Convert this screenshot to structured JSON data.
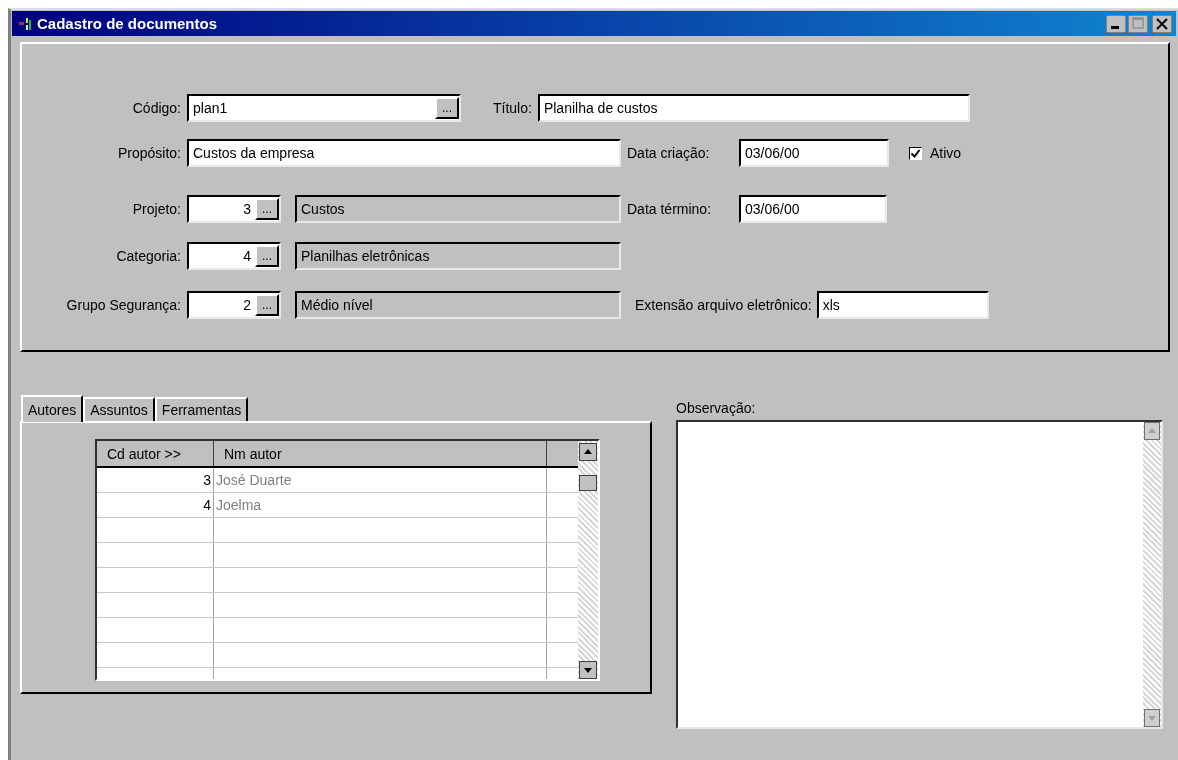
{
  "window": {
    "title": "Cadastro de documentos"
  },
  "codigo": {
    "label": "Código:",
    "value": "plan1",
    "button": "..."
  },
  "titulo": {
    "label": "Título:",
    "value": "Planilha de custos"
  },
  "proposito": {
    "label": "Propósito:",
    "value": "Custos da empresa"
  },
  "data_criacao": {
    "label": "Data criação:",
    "value": "03/06/00"
  },
  "ativo": {
    "label": "Ativo",
    "checked": true
  },
  "lookups": [
    {
      "label": "Projeto:",
      "code": "3",
      "button": "...",
      "description": "Custos"
    },
    {
      "label": "Categoria:",
      "code": "4",
      "button": "...",
      "description": "Planilhas eletrônicas"
    },
    {
      "label": "Grupo Segurança:",
      "code": "2",
      "button": "...",
      "description": "Médio nível"
    }
  ],
  "data_termino": {
    "label": "Data término:",
    "value": "03/06/00"
  },
  "extensao": {
    "label": "Extensão arquivo eletrônico:",
    "value": "xls"
  },
  "tabs": [
    {
      "label": "Autores",
      "selected": true
    },
    {
      "label": "Assuntos",
      "selected": false
    },
    {
      "label": "Ferramentas",
      "selected": false
    }
  ],
  "autores": {
    "columns": [
      "Cd autor >>",
      "Nm autor"
    ],
    "rows": [
      {
        "cd": "3",
        "nome": "José Duarte"
      },
      {
        "cd": "4",
        "nome": "Joelma"
      }
    ]
  },
  "observacao": {
    "label": "Observação:"
  }
}
